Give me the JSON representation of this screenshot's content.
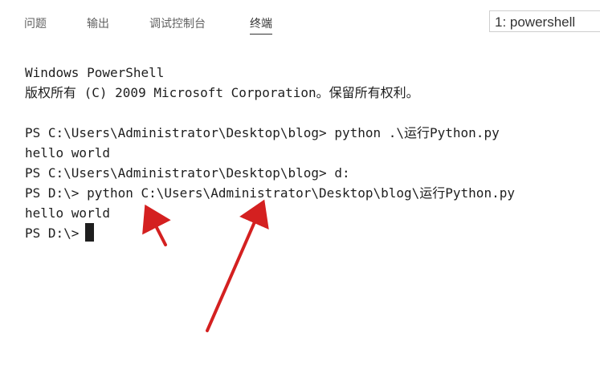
{
  "tabs": {
    "problems": "问题",
    "output": "输出",
    "debug_console": "调试控制台",
    "terminal": "终端"
  },
  "terminal_selector": {
    "value": "1: powershell"
  },
  "terminal": {
    "lines": [
      "Windows PowerShell",
      "版权所有 (C) 2009 Microsoft Corporation。保留所有权利。",
      "",
      "PS C:\\Users\\Administrator\\Desktop\\blog> python .\\运行Python.py",
      "hello world",
      "PS C:\\Users\\Administrator\\Desktop\\blog> d:",
      "PS D:\\> python C:\\Users\\Administrator\\Desktop\\blog\\运行Python.py",
      "hello world",
      "PS D:\\>"
    ]
  },
  "colors": {
    "arrow": "#d42020",
    "text": "#1e1e1e",
    "tab_inactive": "#616161",
    "tab_active": "#333333"
  }
}
